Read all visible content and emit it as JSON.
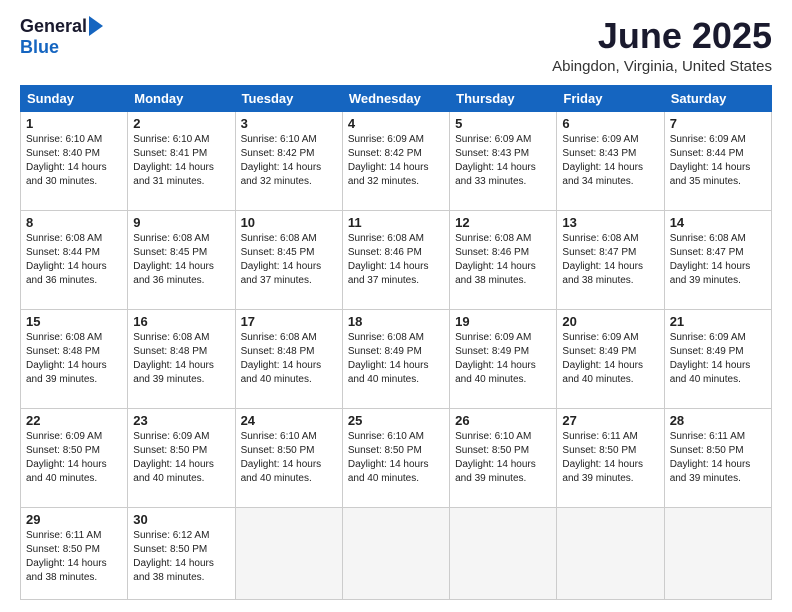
{
  "header": {
    "logo_general": "General",
    "logo_blue": "Blue",
    "month": "June 2025",
    "location": "Abingdon, Virginia, United States"
  },
  "weekdays": [
    "Sunday",
    "Monday",
    "Tuesday",
    "Wednesday",
    "Thursday",
    "Friday",
    "Saturday"
  ],
  "weeks": [
    [
      {
        "day": "1",
        "lines": [
          "Sunrise: 6:10 AM",
          "Sunset: 8:40 PM",
          "Daylight: 14 hours",
          "and 30 minutes."
        ]
      },
      {
        "day": "2",
        "lines": [
          "Sunrise: 6:10 AM",
          "Sunset: 8:41 PM",
          "Daylight: 14 hours",
          "and 31 minutes."
        ]
      },
      {
        "day": "3",
        "lines": [
          "Sunrise: 6:10 AM",
          "Sunset: 8:42 PM",
          "Daylight: 14 hours",
          "and 32 minutes."
        ]
      },
      {
        "day": "4",
        "lines": [
          "Sunrise: 6:09 AM",
          "Sunset: 8:42 PM",
          "Daylight: 14 hours",
          "and 32 minutes."
        ]
      },
      {
        "day": "5",
        "lines": [
          "Sunrise: 6:09 AM",
          "Sunset: 8:43 PM",
          "Daylight: 14 hours",
          "and 33 minutes."
        ]
      },
      {
        "day": "6",
        "lines": [
          "Sunrise: 6:09 AM",
          "Sunset: 8:43 PM",
          "Daylight: 14 hours",
          "and 34 minutes."
        ]
      },
      {
        "day": "7",
        "lines": [
          "Sunrise: 6:09 AM",
          "Sunset: 8:44 PM",
          "Daylight: 14 hours",
          "and 35 minutes."
        ]
      }
    ],
    [
      {
        "day": "8",
        "lines": [
          "Sunrise: 6:08 AM",
          "Sunset: 8:44 PM",
          "Daylight: 14 hours",
          "and 36 minutes."
        ]
      },
      {
        "day": "9",
        "lines": [
          "Sunrise: 6:08 AM",
          "Sunset: 8:45 PM",
          "Daylight: 14 hours",
          "and 36 minutes."
        ]
      },
      {
        "day": "10",
        "lines": [
          "Sunrise: 6:08 AM",
          "Sunset: 8:45 PM",
          "Daylight: 14 hours",
          "and 37 minutes."
        ]
      },
      {
        "day": "11",
        "lines": [
          "Sunrise: 6:08 AM",
          "Sunset: 8:46 PM",
          "Daylight: 14 hours",
          "and 37 minutes."
        ]
      },
      {
        "day": "12",
        "lines": [
          "Sunrise: 6:08 AM",
          "Sunset: 8:46 PM",
          "Daylight: 14 hours",
          "and 38 minutes."
        ]
      },
      {
        "day": "13",
        "lines": [
          "Sunrise: 6:08 AM",
          "Sunset: 8:47 PM",
          "Daylight: 14 hours",
          "and 38 minutes."
        ]
      },
      {
        "day": "14",
        "lines": [
          "Sunrise: 6:08 AM",
          "Sunset: 8:47 PM",
          "Daylight: 14 hours",
          "and 39 minutes."
        ]
      }
    ],
    [
      {
        "day": "15",
        "lines": [
          "Sunrise: 6:08 AM",
          "Sunset: 8:48 PM",
          "Daylight: 14 hours",
          "and 39 minutes."
        ]
      },
      {
        "day": "16",
        "lines": [
          "Sunrise: 6:08 AM",
          "Sunset: 8:48 PM",
          "Daylight: 14 hours",
          "and 39 minutes."
        ]
      },
      {
        "day": "17",
        "lines": [
          "Sunrise: 6:08 AM",
          "Sunset: 8:48 PM",
          "Daylight: 14 hours",
          "and 40 minutes."
        ]
      },
      {
        "day": "18",
        "lines": [
          "Sunrise: 6:08 AM",
          "Sunset: 8:49 PM",
          "Daylight: 14 hours",
          "and 40 minutes."
        ]
      },
      {
        "day": "19",
        "lines": [
          "Sunrise: 6:09 AM",
          "Sunset: 8:49 PM",
          "Daylight: 14 hours",
          "and 40 minutes."
        ]
      },
      {
        "day": "20",
        "lines": [
          "Sunrise: 6:09 AM",
          "Sunset: 8:49 PM",
          "Daylight: 14 hours",
          "and 40 minutes."
        ]
      },
      {
        "day": "21",
        "lines": [
          "Sunrise: 6:09 AM",
          "Sunset: 8:49 PM",
          "Daylight: 14 hours",
          "and 40 minutes."
        ]
      }
    ],
    [
      {
        "day": "22",
        "lines": [
          "Sunrise: 6:09 AM",
          "Sunset: 8:50 PM",
          "Daylight: 14 hours",
          "and 40 minutes."
        ]
      },
      {
        "day": "23",
        "lines": [
          "Sunrise: 6:09 AM",
          "Sunset: 8:50 PM",
          "Daylight: 14 hours",
          "and 40 minutes."
        ]
      },
      {
        "day": "24",
        "lines": [
          "Sunrise: 6:10 AM",
          "Sunset: 8:50 PM",
          "Daylight: 14 hours",
          "and 40 minutes."
        ]
      },
      {
        "day": "25",
        "lines": [
          "Sunrise: 6:10 AM",
          "Sunset: 8:50 PM",
          "Daylight: 14 hours",
          "and 40 minutes."
        ]
      },
      {
        "day": "26",
        "lines": [
          "Sunrise: 6:10 AM",
          "Sunset: 8:50 PM",
          "Daylight: 14 hours",
          "and 39 minutes."
        ]
      },
      {
        "day": "27",
        "lines": [
          "Sunrise: 6:11 AM",
          "Sunset: 8:50 PM",
          "Daylight: 14 hours",
          "and 39 minutes."
        ]
      },
      {
        "day": "28",
        "lines": [
          "Sunrise: 6:11 AM",
          "Sunset: 8:50 PM",
          "Daylight: 14 hours",
          "and 39 minutes."
        ]
      }
    ],
    [
      {
        "day": "29",
        "lines": [
          "Sunrise: 6:11 AM",
          "Sunset: 8:50 PM",
          "Daylight: 14 hours",
          "and 38 minutes."
        ]
      },
      {
        "day": "30",
        "lines": [
          "Sunrise: 6:12 AM",
          "Sunset: 8:50 PM",
          "Daylight: 14 hours",
          "and 38 minutes."
        ]
      },
      null,
      null,
      null,
      null,
      null
    ]
  ]
}
